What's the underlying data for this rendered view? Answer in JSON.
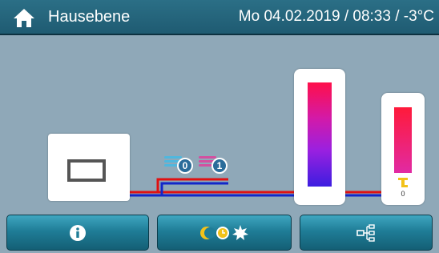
{
  "header": {
    "title": "Hausebene",
    "datetime": "Mo 04.02.2019 / 08:33 / -3°C"
  },
  "circuits": [
    {
      "number": "0",
      "icon": "heating-circuit-icon",
      "color": "#4fb7de"
    },
    {
      "number": "1",
      "icon": "heating-circuit-icon",
      "color": "#d34fa0"
    }
  ],
  "tank_small": {
    "tap_icon": "hot-water-tap-icon",
    "tap_value": "0"
  },
  "pipes": {
    "supply_color": "#e01111",
    "return_color": "#1226c9"
  },
  "footer": {
    "info_icon": "info-icon",
    "mode_icons": [
      "moon-icon",
      "clock-icon",
      "sun-icon"
    ],
    "tree_icon": "system-tree-icon"
  }
}
